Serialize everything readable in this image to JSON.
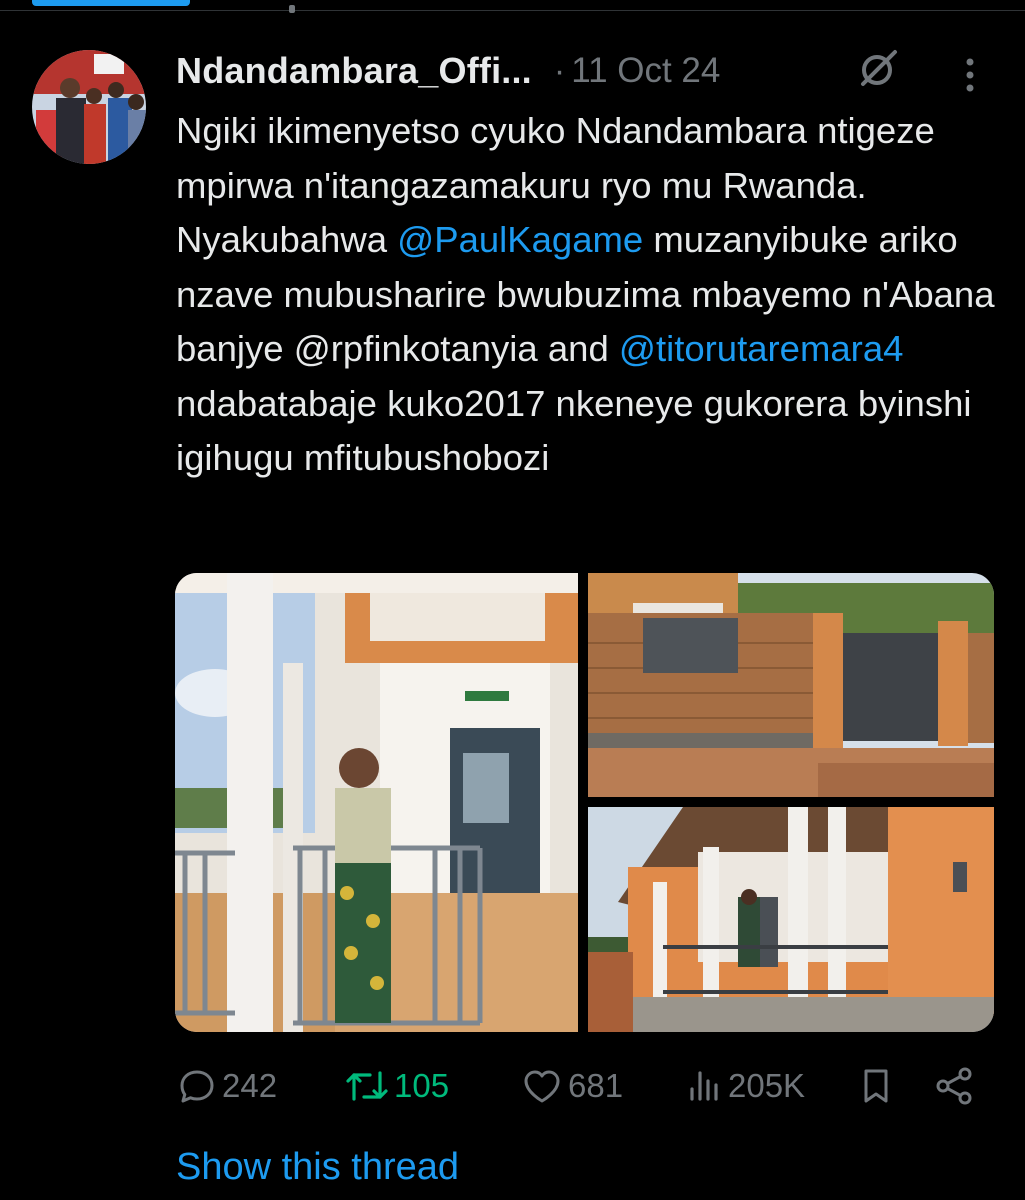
{
  "colors": {
    "background": "#000000",
    "text_primary": "#e7e9ea",
    "text_secondary": "#71767b",
    "link": "#1d9bf0",
    "repost_active": "#00ba7c"
  },
  "post": {
    "author_name": "Ndandambara_Offi...",
    "separator": "·",
    "time": "11 Oct 24",
    "text": {
      "part1": "Ngiki ikimenyetso cyuko Ndandambara ntigeze mpirwa n'itangazamakuru ryo mu Rwanda. Nyakubahwa ",
      "mention1": "@PaulKagame",
      "part2": " muzanyibuke ariko nzave mubusharire bwubuzima mbayemo n'Abana banjye @rpfinkotanyia and ",
      "mention2": "@titorutaremara4",
      "part3": " ndabatabaje kuko2017 nkeneye gukorera byinshi igihugu mfitubushobozi"
    },
    "icons": {
      "grok": "grok-icon",
      "more": "more-options-icon"
    }
  },
  "actions": {
    "reply_count": "242",
    "repost_count": "105",
    "like_count": "681",
    "views_count": "205K",
    "icons": [
      "reply-icon",
      "repost-icon",
      "like-icon",
      "views-icon",
      "bookmark-icon",
      "share-icon"
    ]
  },
  "thread_link": "Show this thread"
}
